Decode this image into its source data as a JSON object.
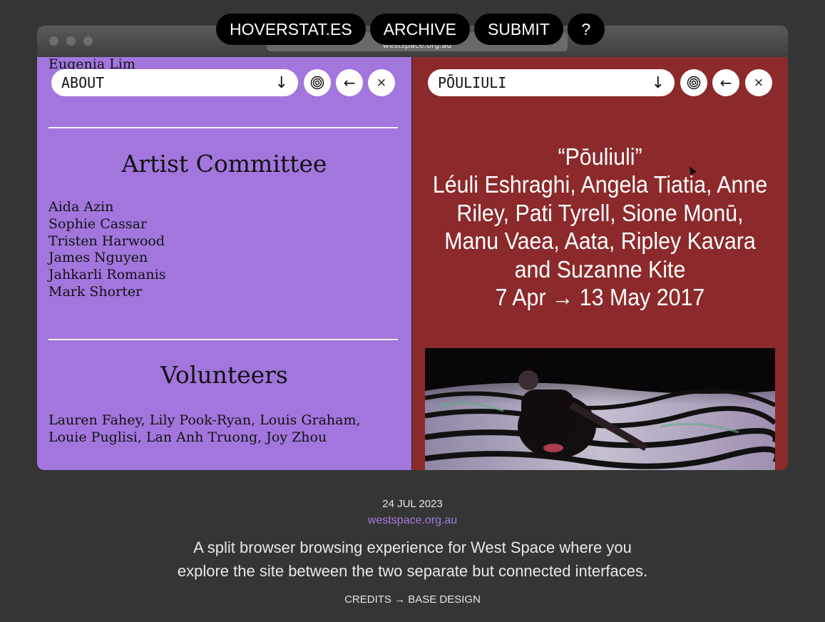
{
  "nav": {
    "items": [
      "HOVERSTAT.ES",
      "ARCHIVE",
      "SUBMIT",
      "?"
    ]
  },
  "browser": {
    "url": "westspace.org.au"
  },
  "left_pane": {
    "background": "#a276dd",
    "select_label": "ABOUT",
    "scroll_fragment": "Eugenia Lim",
    "committee_heading": "Artist Committee",
    "committee_members": [
      "Aida Azin",
      "Sophie Cassar",
      "Tristen Harwood",
      "James Nguyen",
      "Jahkarli Romanis",
      "Mark Shorter"
    ],
    "volunteers_heading": "Volunteers",
    "volunteers_lines": [
      "Lauren Fahey, Lily Pook-Ryan, Louis Graham,",
      "Louie Puglisi, Lan Anh Truong, Joy Zhou"
    ]
  },
  "right_pane": {
    "background": "#8c2a2b",
    "select_label": "PŌULIULI",
    "title_lines": [
      "“Pōuliuli”",
      "Léuli Eshraghi, Angela Tiatia, Anne",
      "Riley, Pati Tyrell, Sione Monū,",
      "Manu Vaea, Aata, Ripley Kavara",
      "and Suzanne Kite",
      "7 Apr → 13 May 2017"
    ]
  },
  "controls": {
    "dropdown_icon": "arrow-down-icon",
    "target_icon": "target-icon",
    "back_icon": "arrow-left-icon",
    "close_icon": "close-icon"
  },
  "footer": {
    "date": "24 JUL 2023",
    "site": "westspace.org.au",
    "description_lines": [
      "A split browser browsing experience for West Space where you",
      "explore the site between the two separate but connected interfaces."
    ],
    "credits": "CREDITS → BASE DESIGN"
  },
  "colors": {
    "page_bg": "#353535",
    "link": "#9f7be0"
  }
}
